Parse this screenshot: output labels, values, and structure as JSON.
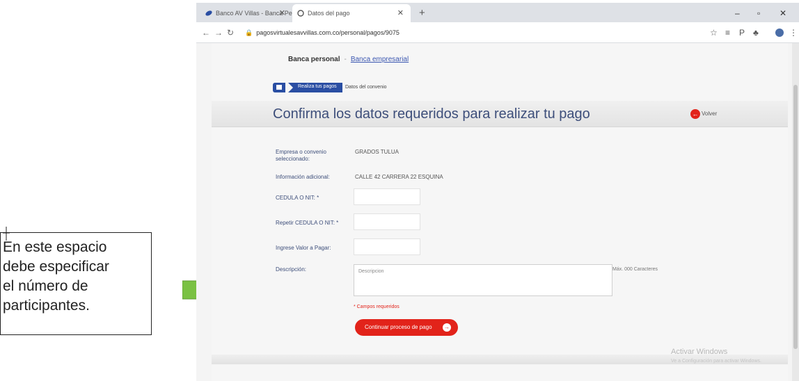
{
  "annotation": {
    "lines": [
      "En este espacio",
      "debe especificar",
      "el número de",
      "participantes."
    ],
    "arrow_color": "#7ac143"
  },
  "browser": {
    "tabs": [
      {
        "title": "Banco AV Villas - Banca Personal",
        "icon": "bank-favicon-icon"
      },
      {
        "title": "Datos del pago",
        "icon": "globe-favicon-icon"
      }
    ],
    "url": "pagosvirtualesavvillas.com.co/personal/pagos/9075"
  },
  "page": {
    "nav": {
      "personal": "Banca personal",
      "sep": "-",
      "business": "Banca empresarial"
    },
    "breadcrumb": {
      "step": "Realiza tus pagos",
      "current": "Datos del convenio"
    },
    "title": "Confirma los datos requeridos para realizar tu pago",
    "back_label": "Volver",
    "form": {
      "company_label": "Empresa o convenio seleccionado:",
      "company_value": "GRADOS TULUA",
      "info_label": "Información adicional:",
      "info_value": "CALLE 42 CARRERA 22 ESQUINA",
      "id_label": "CEDULA O NIT: *",
      "repeat_id_label": "Repetir CEDULA O NIT: *",
      "amount_label": "Ingrese Valor a Pagar:",
      "description_label": "Descripción:",
      "description_placeholder": "Descripcion",
      "max_chars": "Máx. 000 Caracteres",
      "required_note": "* Campos requeridos",
      "continue_label": "Continuar proceso de pago"
    },
    "watermark": {
      "line1": "Activar Windows",
      "line2": "Ve a Configuración para activar Windows."
    },
    "colors": {
      "accent_red": "#e2231a",
      "brand_blue": "#2a4ea3",
      "title_blue": "#3d4e7a"
    }
  }
}
